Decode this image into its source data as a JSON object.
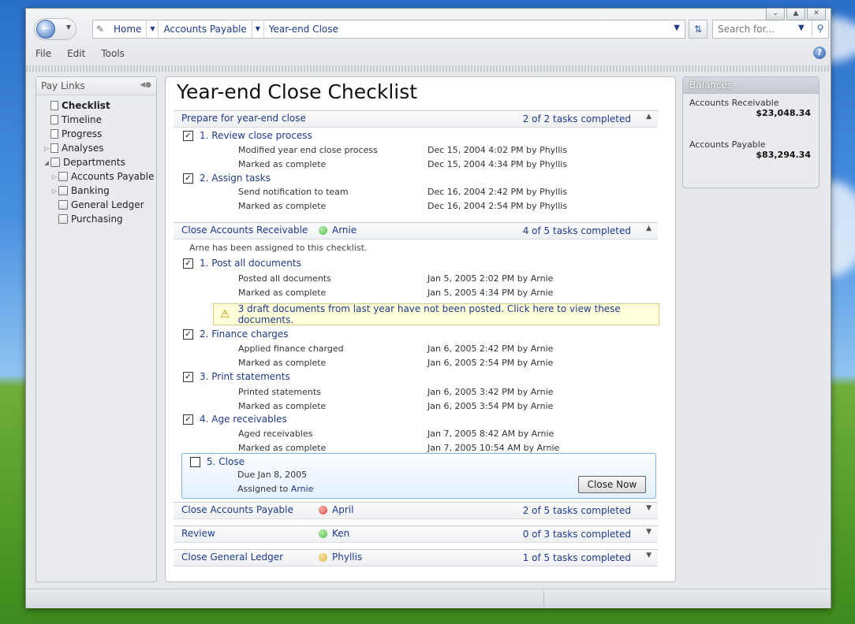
{
  "nav": {
    "breadcrumbs": [
      "Home",
      "Accounts Payable",
      "Year-end Close"
    ],
    "search_placeholder": "Search for..."
  },
  "menu": [
    "File",
    "Edit",
    "Tools"
  ],
  "sidebar": {
    "title": "Pay Links",
    "items": [
      {
        "label": "Checklist",
        "bold": true
      },
      {
        "label": "Timeline"
      },
      {
        "label": "Progress"
      },
      {
        "label": "Analyses"
      },
      {
        "label": "Departments"
      },
      {
        "label": "Accounts Payable"
      },
      {
        "label": "Banking"
      },
      {
        "label": "General Ledger"
      },
      {
        "label": "Purchasing"
      }
    ]
  },
  "page": {
    "title": "Year-end Close Checklist",
    "sections": [
      {
        "title": "Prepare for year-end close",
        "count": "2 of 2 tasks completed",
        "tasks": [
          {
            "label": "1. Review close process",
            "details": [
              {
                "text": "Modified year end close process",
                "when": "Dec 15, 2004 4:02 PM by Phyllis"
              },
              {
                "text": "Marked as complete",
                "when": "Dec 15, 2004 4:34 PM by Phyllis"
              }
            ]
          },
          {
            "label": "2. Assign tasks",
            "details": [
              {
                "text": "Send notification to team",
                "when": "Dec 16, 2004 2:42 PM by Phyllis"
              },
              {
                "text": "Marked as complete",
                "when": "Dec 16, 2004 2:54 PM by Phyllis"
              }
            ]
          }
        ]
      },
      {
        "title": "Close Accounts Receivable",
        "assignee": "Arnie",
        "count": "4 of 5 tasks completed",
        "note": "Arne has been assigned to this checklist.",
        "notice": "3 draft documents from last year have not been posted. Click here to view these documents.",
        "tasks": [
          {
            "label": "1. Post all documents",
            "details": [
              {
                "text": "Posted all documents",
                "when": "Jan 5, 2005 2:02 PM by Arnie"
              },
              {
                "text": "Marked as complete",
                "when": "Jan 5, 2005 4:34 PM by Arnie"
              }
            ]
          },
          {
            "label": "2. Finance charges",
            "details": [
              {
                "text": "Applied finance charged",
                "when": "Jan 6, 2005 2:42 PM by Arnie"
              },
              {
                "text": "Marked as complete",
                "when": "Jan 6, 2005 2:54 PM by Arnie"
              }
            ]
          },
          {
            "label": "3. Print statements",
            "details": [
              {
                "text": "Printed statements",
                "when": "Jan 6, 2005 3:42 PM by Arnie"
              },
              {
                "text": "Marked as complete",
                "when": "Jan 6, 2005 3:54 PM by Arnie"
              }
            ]
          },
          {
            "label": "4. Age receivables",
            "details": [
              {
                "text": "Aged receivables",
                "when": "Jan 7, 2005 8:42 AM by Arnie"
              },
              {
                "text": "Marked as complete",
                "when": "Jan 7, 2005 10:54 AM by Arnie"
              }
            ]
          },
          {
            "label": "5. Close",
            "due": "Due Jan 8, 2005",
            "assigned_prefix": "Assigned to",
            "assigned_to": "Arnie",
            "button": "Close Now"
          }
        ]
      },
      {
        "title": "Close Accounts Payable",
        "assignee": "April",
        "count": "2 of 5 tasks completed",
        "dot": "#d9403a"
      },
      {
        "title": "Review",
        "assignee": "Ken",
        "count": "0 of 3 tasks completed",
        "dot": "#4fb84a"
      },
      {
        "title": "Close General Ledger",
        "assignee": "Phyllis",
        "count": "1 of 5 tasks completed",
        "dot": "#e0b83a"
      }
    ]
  },
  "balances": {
    "title": "Balances",
    "items": [
      {
        "label": "Accounts Receivable",
        "value": "$23,048.34"
      },
      {
        "label": "Accounts Payable",
        "value": "$83,294.34"
      }
    ]
  },
  "colors": {
    "accent": "#1e3a8a",
    "arnie_dot": "#4fb84a"
  }
}
